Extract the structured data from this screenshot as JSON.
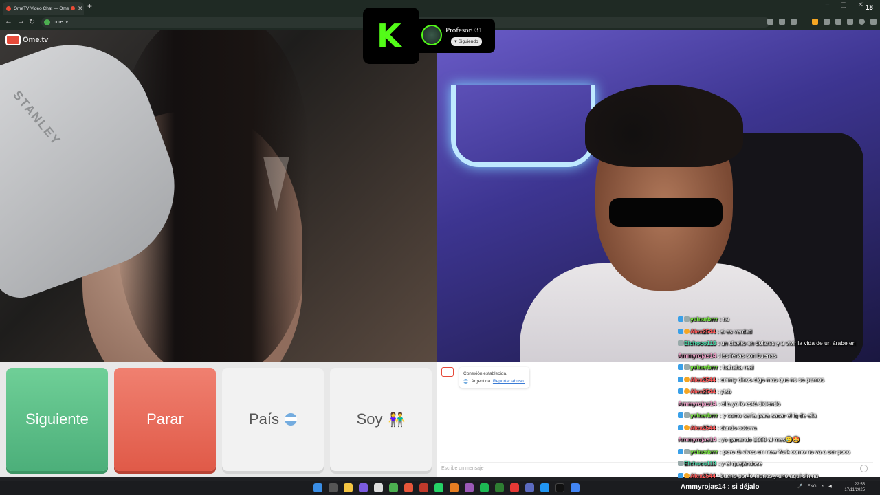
{
  "browser": {
    "tab_title": "OmeTV Video Chat — Ome",
    "url": "ome.tv",
    "side_number": "18"
  },
  "ome": {
    "logo_text": "Ome.tv"
  },
  "stream": {
    "streamer_name": "Profesor031",
    "follow_label": "Siguiendo",
    "kick_letter": "K"
  },
  "buttons": {
    "next": "Siguiente",
    "stop": "Parar",
    "country": "País",
    "gender": "Soy"
  },
  "chat": {
    "connection": "Conexión establecida.",
    "country": "Argentina.",
    "report": "Reportar abuso.",
    "placeholder": "Escribe un mensaje"
  },
  "kick_chat": [
    {
      "badges": [
        "blue",
        "gray"
      ],
      "user": "yelnerbrrr",
      "color": "green",
      "text": ": ne"
    },
    {
      "badges": [
        "blue",
        "orange"
      ],
      "user": "Alex2544",
      "color": "red",
      "text": ": si es verdad"
    },
    {
      "badges": [
        "gray"
      ],
      "user": "Elchoco113",
      "color": "teal",
      "text": ": un clavito en dolares y a vivir la vida de un árabe en"
    },
    {
      "badges": [],
      "user": "Ammyrojas14",
      "color": "pink",
      "text": ": las ferias son buenas"
    },
    {
      "badges": [
        "blue",
        "gray"
      ],
      "user": "yelnerbrrr",
      "color": "green",
      "text": ": hahaha real"
    },
    {
      "badges": [
        "blue",
        "orange"
      ],
      "user": "Alex2544",
      "color": "red",
      "text": ": ammy dinos algo mas que no se parnos"
    },
    {
      "badges": [
        "blue",
        "orange"
      ],
      "user": "Alex2544",
      "color": "red",
      "text": ": ytsb"
    },
    {
      "badges": [],
      "user": "Ammyrojas14",
      "color": "pink",
      "text": ": ella ya lo está diciendo"
    },
    {
      "badges": [
        "blue",
        "gray"
      ],
      "user": "yelnerbrrr",
      "color": "green",
      "text": ": y como sería para sacar el iq de ella"
    },
    {
      "badges": [
        "blue",
        "orange"
      ],
      "user": "Alex2544",
      "color": "red",
      "text": ": dando cotorra"
    },
    {
      "badges": [],
      "user": "Ammyrojas14",
      "color": "pink",
      "text": ": yo ganando 1000 al mes🥲🤩"
    },
    {
      "badges": [
        "blue",
        "gray"
      ],
      "user": "yelnerbrrr",
      "color": "green",
      "text": ": pero tú vives en new York como no va a ser poco"
    },
    {
      "badges": [
        "gray"
      ],
      "user": "Elchoco113",
      "color": "teal",
      "text": ": y el quejándose"
    },
    {
      "badges": [
        "blue",
        "orange"
      ],
      "user": "Alex2544",
      "color": "red",
      "text": ": bueno por lo menos y uno aquí sin na"
    }
  ],
  "overlay_message": "Ammyrojas14 : si déjalo",
  "taskbar": {
    "lang": "ENG",
    "time": "22:55",
    "date": "17/11/2025"
  }
}
